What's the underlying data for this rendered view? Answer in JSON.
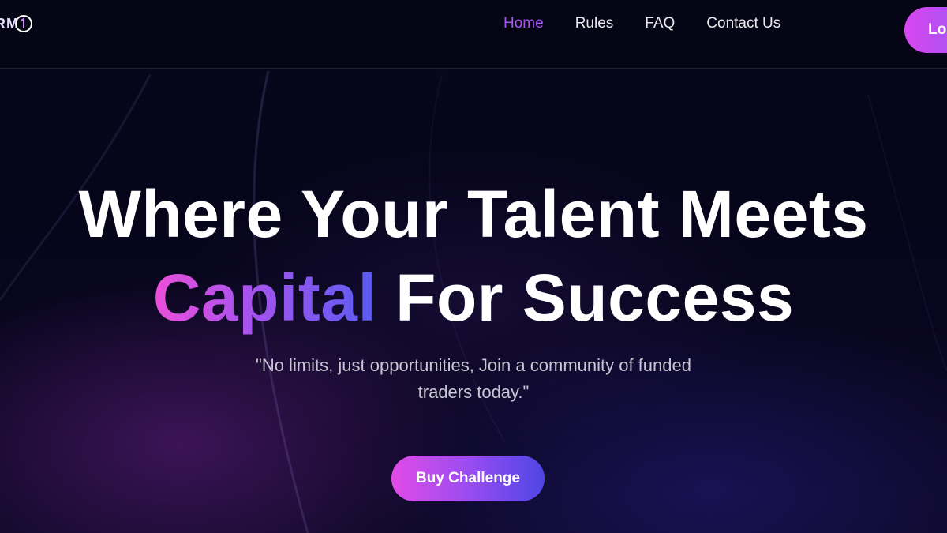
{
  "brand": {
    "logo_text": "RM",
    "accent_color": "#a855f7",
    "gradient_colors": [
      "#ec4fd9",
      "#a453ef",
      "#5a5cf2"
    ]
  },
  "nav": {
    "items": [
      {
        "label": "Home",
        "active": true
      },
      {
        "label": "Rules",
        "active": false
      },
      {
        "label": "FAQ",
        "active": false
      },
      {
        "label": "Contact Us",
        "active": false
      }
    ],
    "login_label": "Lo"
  },
  "hero": {
    "title_line1": "Where Your Talent Meets",
    "title_highlight": "Capital",
    "title_line2_rest": " For Success",
    "subtitle": "\"No limits, just opportunities, Join a community of funded traders today.\"",
    "cta_label": "Buy Challenge"
  }
}
